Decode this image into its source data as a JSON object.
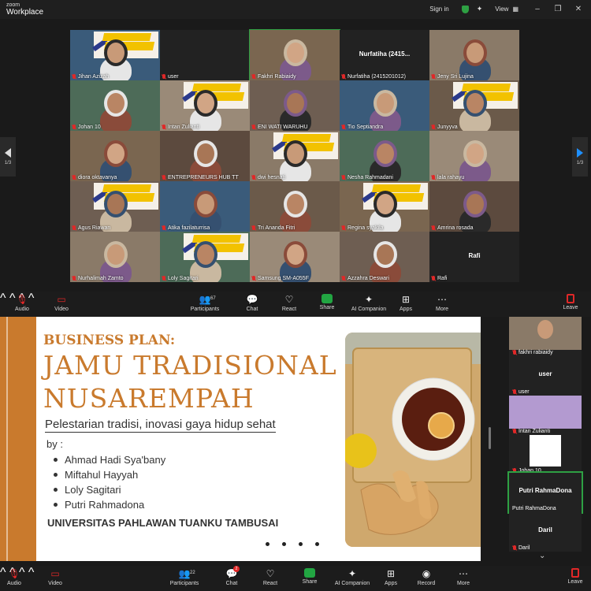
{
  "app": {
    "logo_top": "zoom",
    "logo_bottom": "Workplace"
  },
  "titlebar": {
    "sign_in": "Sign in",
    "view": "View"
  },
  "gallery": {
    "page_indicator_left": "1/3",
    "page_indicator_right": "1/3",
    "tiles": [
      {
        "name": "Jihan Azizah",
        "kind": "person"
      },
      {
        "name": "user",
        "kind": "text"
      },
      {
        "name": "Fakhri Rabiaidy",
        "kind": "person"
      },
      {
        "name": "Nurfatiha (2415201012)",
        "kind": "text",
        "center": "Nurfatiha (2415..."
      },
      {
        "name": "Jeny Sri Lujina",
        "kind": "person"
      },
      {
        "name": "Johan 10",
        "kind": "person"
      },
      {
        "name": "Intan Zulianti",
        "kind": "person"
      },
      {
        "name": "ENI WATI WARUHU",
        "kind": "person"
      },
      {
        "name": "Tio Septiandra",
        "kind": "person"
      },
      {
        "name": "Junyyva",
        "kind": "person"
      },
      {
        "name": "diora oktavanya",
        "kind": "person"
      },
      {
        "name": "ENTREPRENEURS HUB TT",
        "kind": "person"
      },
      {
        "name": "dwi hesnati",
        "kind": "person"
      },
      {
        "name": "Nesha Rahmadani",
        "kind": "person"
      },
      {
        "name": "lala rahayu",
        "kind": "person"
      },
      {
        "name": "Agus Riawan",
        "kind": "person"
      },
      {
        "name": "Atika fazilaturrisa",
        "kind": "person"
      },
      {
        "name": "Tri Ananda Fitri",
        "kind": "person"
      },
      {
        "name": "Regina syakila",
        "kind": "person"
      },
      {
        "name": "Amrina rosada",
        "kind": "person"
      },
      {
        "name": "Nurhalimah Zamto",
        "kind": "person"
      },
      {
        "name": "Loly Sagitari",
        "kind": "person"
      },
      {
        "name": "Samsung SM-A055F",
        "kind": "person"
      },
      {
        "name": "Azzahra Deswari",
        "kind": "person"
      },
      {
        "name": "Rafi",
        "kind": "text",
        "center": "Rafi"
      }
    ]
  },
  "toolbar_top": {
    "audio": "Audio",
    "video": "Video",
    "participants": "Participants",
    "participants_count": "67",
    "chat": "Chat",
    "react": "React",
    "share": "Share",
    "ai": "AI Companion",
    "apps": "Apps",
    "more": "More",
    "leave": "Leave"
  },
  "slide": {
    "subtitle": "BUSINESS PLAN:",
    "title_line1": "JAMU TRADISIONAL",
    "title_line2": "NUSAREMPAH",
    "tagline": "Pelestarian tradisi, inovasi gaya hidup sehat",
    "by": "by :",
    "authors": [
      "Ahmad Hadi Sya'bany",
      "Miftahul Hayyah",
      "Loly Sagitari",
      "Putri Rahmadona"
    ],
    "university": "UNIVERSITAS PAHLAWAN TUANKU TAMBUSAI"
  },
  "side_panel": {
    "tiles": [
      {
        "name": "fakhri rabiaidy",
        "kind": "person"
      },
      {
        "name": "user",
        "kind": "text",
        "center": "user"
      },
      {
        "name": "Intan Zulianti",
        "kind": "person"
      },
      {
        "name": "Johan 10",
        "kind": "person"
      },
      {
        "name": "Putri RahmaDona",
        "kind": "text",
        "center": "Putri RahmaDona"
      },
      {
        "name": "Daril",
        "kind": "text",
        "center": "Daril"
      }
    ]
  },
  "toolbar_bottom": {
    "audio": "Audio",
    "video": "Video",
    "participants": "Participants",
    "participants_count": "22",
    "chat": "Chat",
    "chat_badge": "2",
    "react": "React",
    "share": "Share",
    "ai": "AI Companion",
    "apps": "Apps",
    "record": "Record",
    "more": "More",
    "leave": "Leave"
  },
  "colors": {
    "accent": "#c97a2d",
    "share_green": "#22a542",
    "mute_red": "#e02828",
    "active_border": "#2ea043"
  }
}
